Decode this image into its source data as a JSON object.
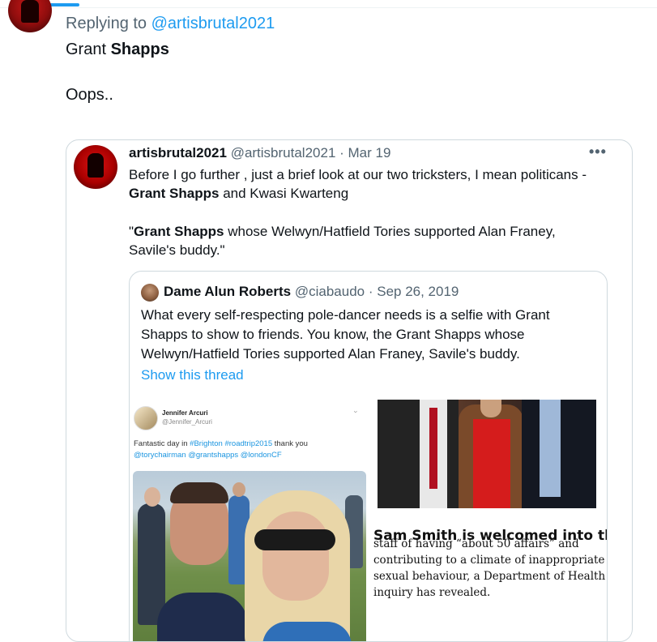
{
  "reply": {
    "replying_to_prefix": "Replying to",
    "replying_to_handle": "@artisbrutal2021",
    "text_part1": "Grant",
    "text_bold": "Shapps",
    "text_line2": "Oops.."
  },
  "quoted_tweet": {
    "display_name": "artisbrutal2021",
    "meta": "@artisbrutal2021 · Mar 19",
    "more_glyph": "•••",
    "line1": "Before I go further , just a brief look at our two tricksters, I mean politicans -",
    "line2_bold": "Grant Shapps",
    "line2_rest": " and Kwasi Kwarteng",
    "line3_quote_open": "\"",
    "line3_bold": "Grant Shapps",
    "line3_rest": " whose Welwyn/Hatfield Tories supported Alan Franey,",
    "line4": "Savile's buddy.\""
  },
  "inner_quote": {
    "display_name": "Dame Alun Roberts",
    "meta": "@ciabaudo · Sep 26, 2019",
    "line1": "What every self-respecting pole-dancer needs is a selfie with Grant",
    "line2": "Shapps to show to friends. You know, the Grant Shapps whose",
    "line3": "Welwyn/Hatfield Tories supported Alan Franey, Savile's buddy.",
    "show_thread": "Show this thread"
  },
  "embedded_screenshot": {
    "name": "Jennifer Arcuri",
    "handle": "@Jennifer_Arcuri",
    "text_prefix": "Fantastic day in ",
    "tag1": "#Brighton",
    "tag2": "#roadtrip2015",
    "text_suffix": " thank you",
    "mention1": "@torychairman",
    "mention2": "@grantshapps",
    "mention3": "@londonCF"
  },
  "article_clipping": {
    "headline_partial": "Sam Smith is welcomed into the",
    "line1": "staff of having “about 50 affairs” and",
    "line2": "contributing to a climate of inappropriate",
    "line3": "sexual behaviour, a Department of Health",
    "line4": "inquiry has revealed."
  },
  "colors": {
    "accent": "#1d9bf0",
    "text_primary": "#0f1419",
    "text_secondary": "#536471",
    "border": "#cfd9de"
  }
}
